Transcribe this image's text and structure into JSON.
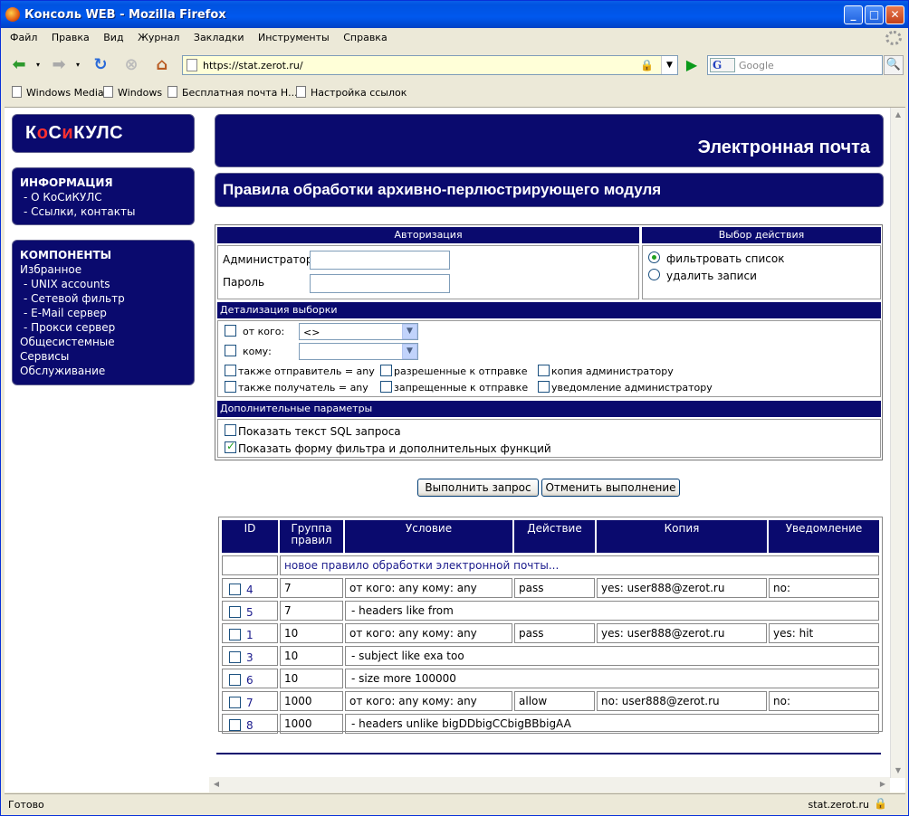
{
  "window": {
    "title": "Консоль WEB - Mozilla Firefox"
  },
  "menu": [
    "Файл",
    "Правка",
    "Вид",
    "Журнал",
    "Закладки",
    "Инструменты",
    "Справка"
  ],
  "nav": {
    "url": "https://stat.zerot.ru/",
    "search_placeholder": "Google",
    "search_engine": "G"
  },
  "bookmarks": [
    "Windows Media",
    "Windows",
    "Бесплатная почта Н...",
    "Настройка ссылок"
  ],
  "logo": {
    "a": "К",
    "b": "о",
    "c": "С",
    "d": "и",
    "e": "КУЛС"
  },
  "sidebar": {
    "info_title": "ИНФОРМАЦИЯ",
    "info_items": [
      "- О КоСиКУЛС",
      "- Ссылки, контакты"
    ],
    "comp_title": "КОМПОНЕНТЫ",
    "comp_items": [
      "Избранное",
      "- UNIX accounts",
      "- Сетевой фильтр",
      "- E-Mail сервер",
      "- Прокси сервер",
      "Общесистемные",
      "Сервисы",
      "Обслуживание"
    ]
  },
  "header": {
    "section": "Электронная почта",
    "page_title": "Правила обработки архивно-перлюстрирующего модуля"
  },
  "form": {
    "auth_title": "Авторизация",
    "action_title": "Выбор действия",
    "admin_label": "Администратор",
    "password_label": "Пароль",
    "radio_filter": "фильтровать список",
    "radio_delete": "удалить записи",
    "detail_title": "Детализация выборки",
    "from_label": "от кого:",
    "from_value": "<>",
    "to_label": "кому:",
    "to_value": "",
    "also_sender": "также отправитель = any",
    "also_recipient": "также получатель = any",
    "allowed_send": "разрешенные к отправке",
    "forbidden_send": "запрещенные к отправке",
    "copy_admin": "копия администратору",
    "notify_admin": "уведомление администратору",
    "extra_title": "Дополнительные параметры",
    "show_sql": "Показать текст SQL запроса",
    "show_filter": "Показать форму фильтра и дополнительных функций"
  },
  "buttons": {
    "execute": "Выполнить  запрос",
    "cancel": "Отменить выполнение"
  },
  "table": {
    "headers": [
      "ID",
      "Группа правил",
      "Условие",
      "Действие",
      "Копия",
      "Уведомление"
    ],
    "new_rule": "новое правило обработки электронной почты...",
    "rows": [
      {
        "id": "4",
        "group": "7",
        "cond": "от кого: any кому: any",
        "action": "pass",
        "copy": "yes: user888@zerot.ru",
        "notify": "no:"
      },
      {
        "id": "5",
        "group": "7",
        "cond": "- headers like from"
      },
      {
        "id": "1",
        "group": "10",
        "cond": "от кого: any кому: any",
        "action": "pass",
        "copy": "yes: user888@zerot.ru",
        "notify": "yes: hit"
      },
      {
        "id": "3",
        "group": "10",
        "cond": "- subject like exa too"
      },
      {
        "id": "6",
        "group": "10",
        "cond": "- size more 100000"
      },
      {
        "id": "7",
        "group": "1000",
        "cond": "от кого: any кому: any",
        "action": "allow",
        "copy": "no: user888@zerot.ru",
        "notify": "no:"
      },
      {
        "id": "8",
        "group": "1000",
        "cond": "- headers unlike bigDDbigCCbigBBbigAA"
      }
    ]
  },
  "status": {
    "text": "Готово",
    "host": "stat.zerot.ru"
  }
}
